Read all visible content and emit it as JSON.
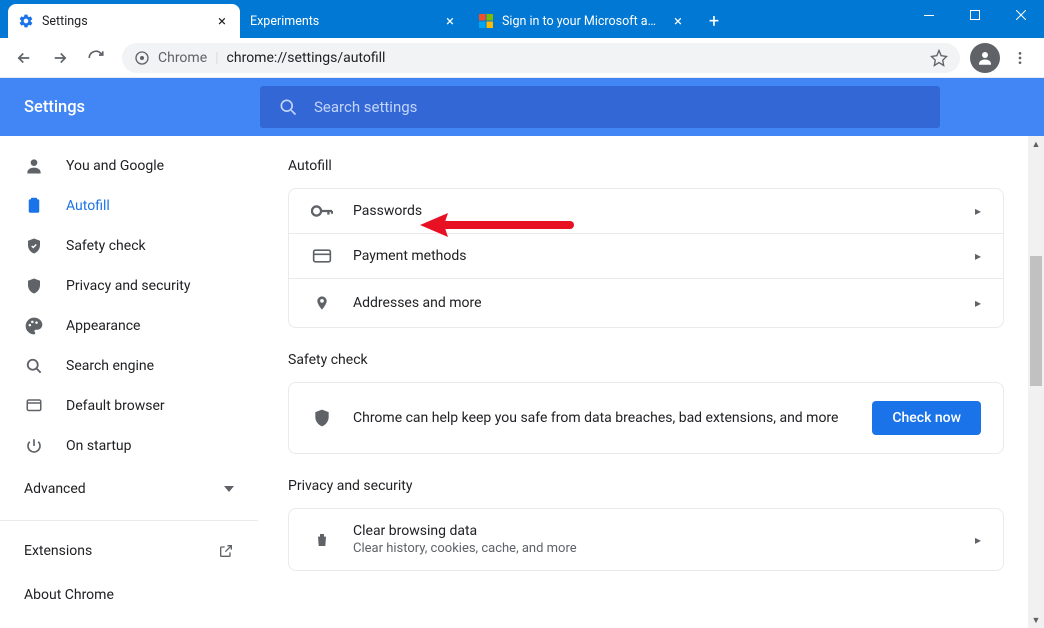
{
  "window": {
    "tabs": [
      {
        "label": "Settings",
        "icon": "gear-blue",
        "active": true
      },
      {
        "label": "Experiments",
        "icon": "none",
        "active": false
      },
      {
        "label": "Sign in to your Microsoft account",
        "icon": "ms",
        "active": false
      }
    ]
  },
  "toolbar": {
    "chrome_label": "Chrome",
    "url": "chrome://settings/autofill"
  },
  "header": {
    "brand": "Settings",
    "search_placeholder": "Search settings"
  },
  "sidebar": {
    "items": [
      {
        "label": "You and Google",
        "icon": "person"
      },
      {
        "label": "Autofill",
        "icon": "clipboard",
        "selected": true
      },
      {
        "label": "Safety check",
        "icon": "shield-check"
      },
      {
        "label": "Privacy and security",
        "icon": "shield"
      },
      {
        "label": "Appearance",
        "icon": "palette"
      },
      {
        "label": "Search engine",
        "icon": "search"
      },
      {
        "label": "Default browser",
        "icon": "browser"
      },
      {
        "label": "On startup",
        "icon": "power"
      }
    ],
    "advanced": "Advanced",
    "extensions": "Extensions",
    "about": "About Chrome"
  },
  "content": {
    "sections": {
      "autofill": {
        "title": "Autofill",
        "rows": [
          {
            "label": "Passwords",
            "icon": "key"
          },
          {
            "label": "Payment methods",
            "icon": "card"
          },
          {
            "label": "Addresses and more",
            "icon": "pin"
          }
        ]
      },
      "safety": {
        "title": "Safety check",
        "desc": "Chrome can help keep you safe from data breaches, bad extensions, and more",
        "button": "Check now"
      },
      "privacy": {
        "title": "Privacy and security",
        "rows": [
          {
            "label": "Clear browsing data",
            "sub": "Clear history, cookies, cache, and more",
            "icon": "trash"
          }
        ]
      }
    }
  }
}
